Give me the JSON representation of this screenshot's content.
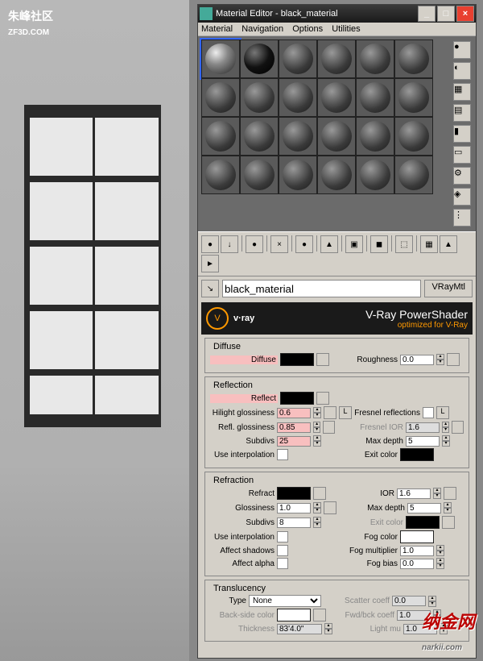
{
  "watermark": {
    "tl": "朱峰社区",
    "tl2": "ZF3D.COM",
    "br": "narkii.com",
    "nk": "纳金网"
  },
  "window": {
    "title": "Material Editor - black_material"
  },
  "menu": {
    "material": "Material",
    "navigation": "Navigation",
    "options": "Options",
    "utilities": "Utilities"
  },
  "material": {
    "name": "black_material",
    "type": "VRayMtl"
  },
  "vray": {
    "brand": "v·ray",
    "line1": "V-Ray PowerShader",
    "line2": "optimized for V-Ray"
  },
  "diffuse": {
    "title": "Diffuse",
    "diffuse_lbl": "Diffuse",
    "roughness_lbl": "Roughness",
    "roughness": "0.0"
  },
  "reflection": {
    "title": "Reflection",
    "reflect_lbl": "Reflect",
    "hilight_lbl": "Hilight glossiness",
    "hilight": "0.6",
    "refl_gloss_lbl": "Refl. glossiness",
    "refl_gloss": "0.85",
    "subdivs_lbl": "Subdivs",
    "subdivs": "25",
    "use_interp": "Use interpolation",
    "L": "L",
    "fresnel": "Fresnel reflections",
    "fresnel_ior_lbl": "Fresnel IOR",
    "fresnel_ior": "1.6",
    "maxdepth_lbl": "Max depth",
    "maxdepth": "5",
    "exit_lbl": "Exit color"
  },
  "refraction": {
    "title": "Refraction",
    "refract_lbl": "Refract",
    "gloss_lbl": "Glossiness",
    "gloss": "1.0",
    "subdivs_lbl": "Subdivs",
    "subdivs": "8",
    "use_interp": "Use interpolation",
    "affect_shadows": "Affect shadows",
    "affect_alpha": "Affect alpha",
    "ior_lbl": "IOR",
    "ior": "1.6",
    "maxdepth_lbl": "Max depth",
    "maxdepth": "5",
    "exit_lbl": "Exit color",
    "fogcolor_lbl": "Fog color",
    "fogmult_lbl": "Fog multiplier",
    "fogmult": "1.0",
    "fogbias_lbl": "Fog bias",
    "fogbias": "0.0"
  },
  "translucency": {
    "title": "Translucency",
    "type_lbl": "Type",
    "type": "None",
    "backcolor_lbl": "Back-side color",
    "thickness_lbl": "Thickness",
    "thickness": "83'4.0\"",
    "scatter_lbl": "Scatter coeff",
    "scatter": "0.0",
    "fwdbck_lbl": "Fwd/bck coeff",
    "fwdbck": "1.0",
    "lightmult_lbl": "Light mu",
    "lightmult": "1.0"
  }
}
